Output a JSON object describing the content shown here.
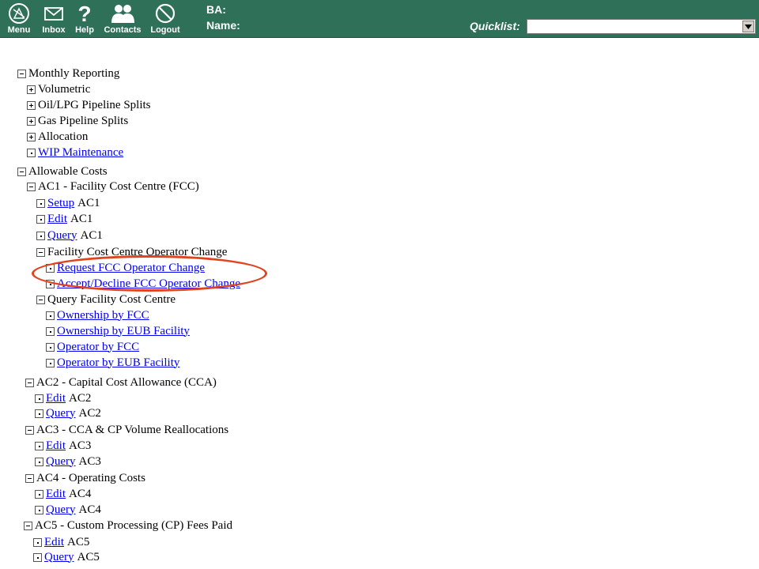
{
  "topbar": {
    "nav": [
      {
        "label": "Menu",
        "icon": "menu-compass-icon"
      },
      {
        "label": "Inbox",
        "icon": "envelope-icon"
      },
      {
        "label": "Help",
        "icon": "question-icon"
      },
      {
        "label": "Contacts",
        "icon": "people-icon"
      },
      {
        "label": "Logout",
        "icon": "no-entry-icon"
      }
    ],
    "ba_label": "BA:",
    "name_label": "Name:",
    "quicklist_label": "Quicklist:",
    "quicklist_value": ""
  },
  "tree": [
    {
      "text": "Monthly Reporting",
      "box": "minus"
    },
    {
      "text": "Volumetric",
      "box": "plus"
    },
    {
      "text": "Oil/LPG Pipeline Splits",
      "box": "plus"
    },
    {
      "text": "Gas Pipeline Splits",
      "box": "plus"
    },
    {
      "text": "Allocation",
      "box": "plus"
    },
    {
      "text": "WIP Maintenance",
      "box": "dot",
      "link": true
    },
    {
      "text": "Allowable Costs",
      "box": "minus"
    },
    {
      "text": "AC1  - Facility Cost Centre (FCC)",
      "box": "minus"
    },
    {
      "text": "Setup",
      "suffix": "AC1",
      "box": "dot",
      "link": true
    },
    {
      "text": "Edit",
      "suffix": "AC1",
      "box": "dot",
      "link": true
    },
    {
      "text": "Query",
      "suffix": "AC1",
      "box": "dot",
      "link": true
    },
    {
      "text": "Facility Cost Centre Operator Change",
      "box": "minus"
    },
    {
      "text": "Request FCC Operator Change",
      "box": "dot",
      "link": true
    },
    {
      "text": "Accept/Decline FCC Operator Change",
      "box": "dot",
      "link": true
    },
    {
      "text": "Query Facility Cost Centre",
      "box": "minus"
    },
    {
      "text": "Ownership by FCC",
      "box": "dot",
      "link": true
    },
    {
      "text": "Ownership by EUB Facility",
      "box": "dot",
      "link": true
    },
    {
      "text": "Operator by FCC",
      "box": "dot",
      "link": true
    },
    {
      "text": "Operator by EUB Facility",
      "box": "dot",
      "link": true
    },
    {
      "text": "AC2  - Capital Cost Allowance (CCA)",
      "box": "minus"
    },
    {
      "text": "Edit",
      "suffix": "AC2",
      "box": "dot",
      "link": true
    },
    {
      "text": "Query",
      "suffix": "AC2",
      "box": "dot",
      "link": true
    },
    {
      "text": "AC3  - CCA & CP Volume Reallocations",
      "box": "minus"
    },
    {
      "text": "Edit",
      "suffix": "AC3",
      "box": "dot",
      "link": true
    },
    {
      "text": "Query",
      "suffix": "AC3",
      "box": "dot",
      "link": true
    },
    {
      "text": "AC4  - Operating Costs",
      "box": "minus"
    },
    {
      "text": "Edit",
      "suffix": "AC4",
      "box": "dot",
      "link": true
    },
    {
      "text": "Query",
      "suffix": "AC4",
      "box": "dot",
      "link": true
    },
    {
      "text": "AC5  - Custom Processing (CP) Fees Paid",
      "box": "minus"
    },
    {
      "text": "Edit",
      "suffix": "AC5",
      "box": "dot",
      "link": true
    },
    {
      "text": "Query",
      "suffix": "AC5",
      "box": "dot",
      "link": true
    }
  ],
  "annotation": {
    "highlight_color": "#e0441f"
  },
  "colors": {
    "topbar": "#2e7058",
    "link": "#0000ee"
  }
}
